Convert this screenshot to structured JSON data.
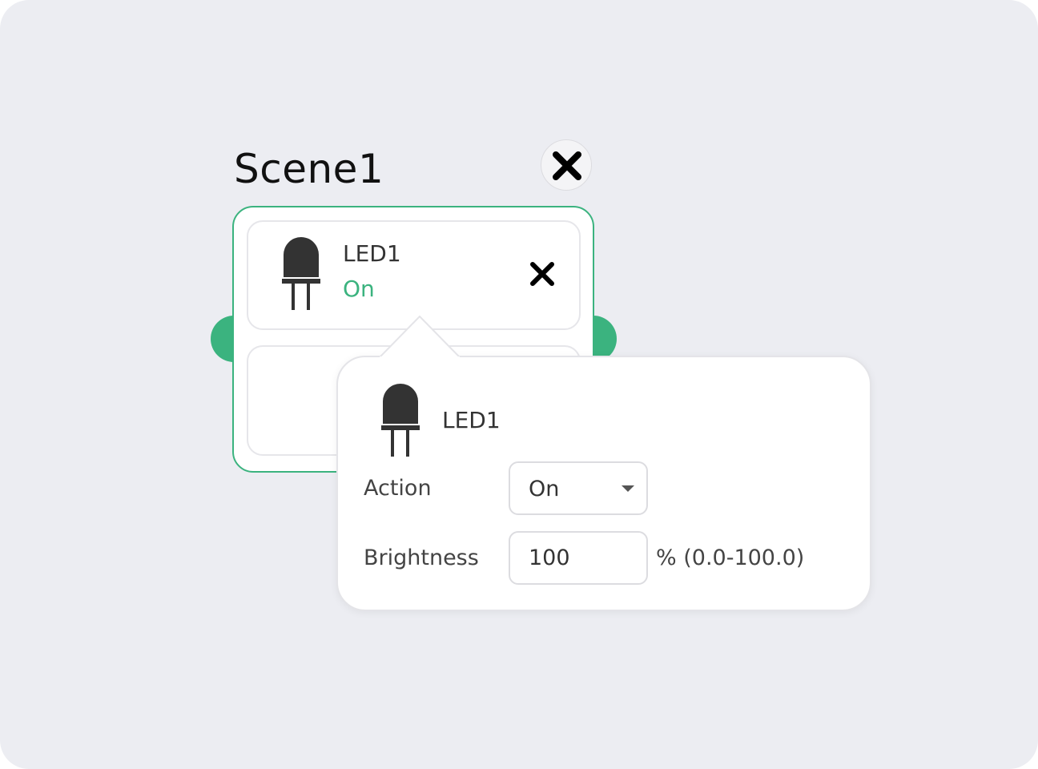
{
  "scene": {
    "title": "Scene1",
    "close_icon": "close-icon",
    "accent_color": "#3bb37f"
  },
  "device": {
    "name": "LED1",
    "state": "On",
    "icon": "led-icon",
    "remove_icon": "close-icon"
  },
  "popover": {
    "device_name": "LED1",
    "icon": "led-icon",
    "action": {
      "label": "Action",
      "value": "On"
    },
    "brightness": {
      "label": "Brightness",
      "value": "100",
      "unit_hint": "% (0.0-100.0)"
    }
  }
}
